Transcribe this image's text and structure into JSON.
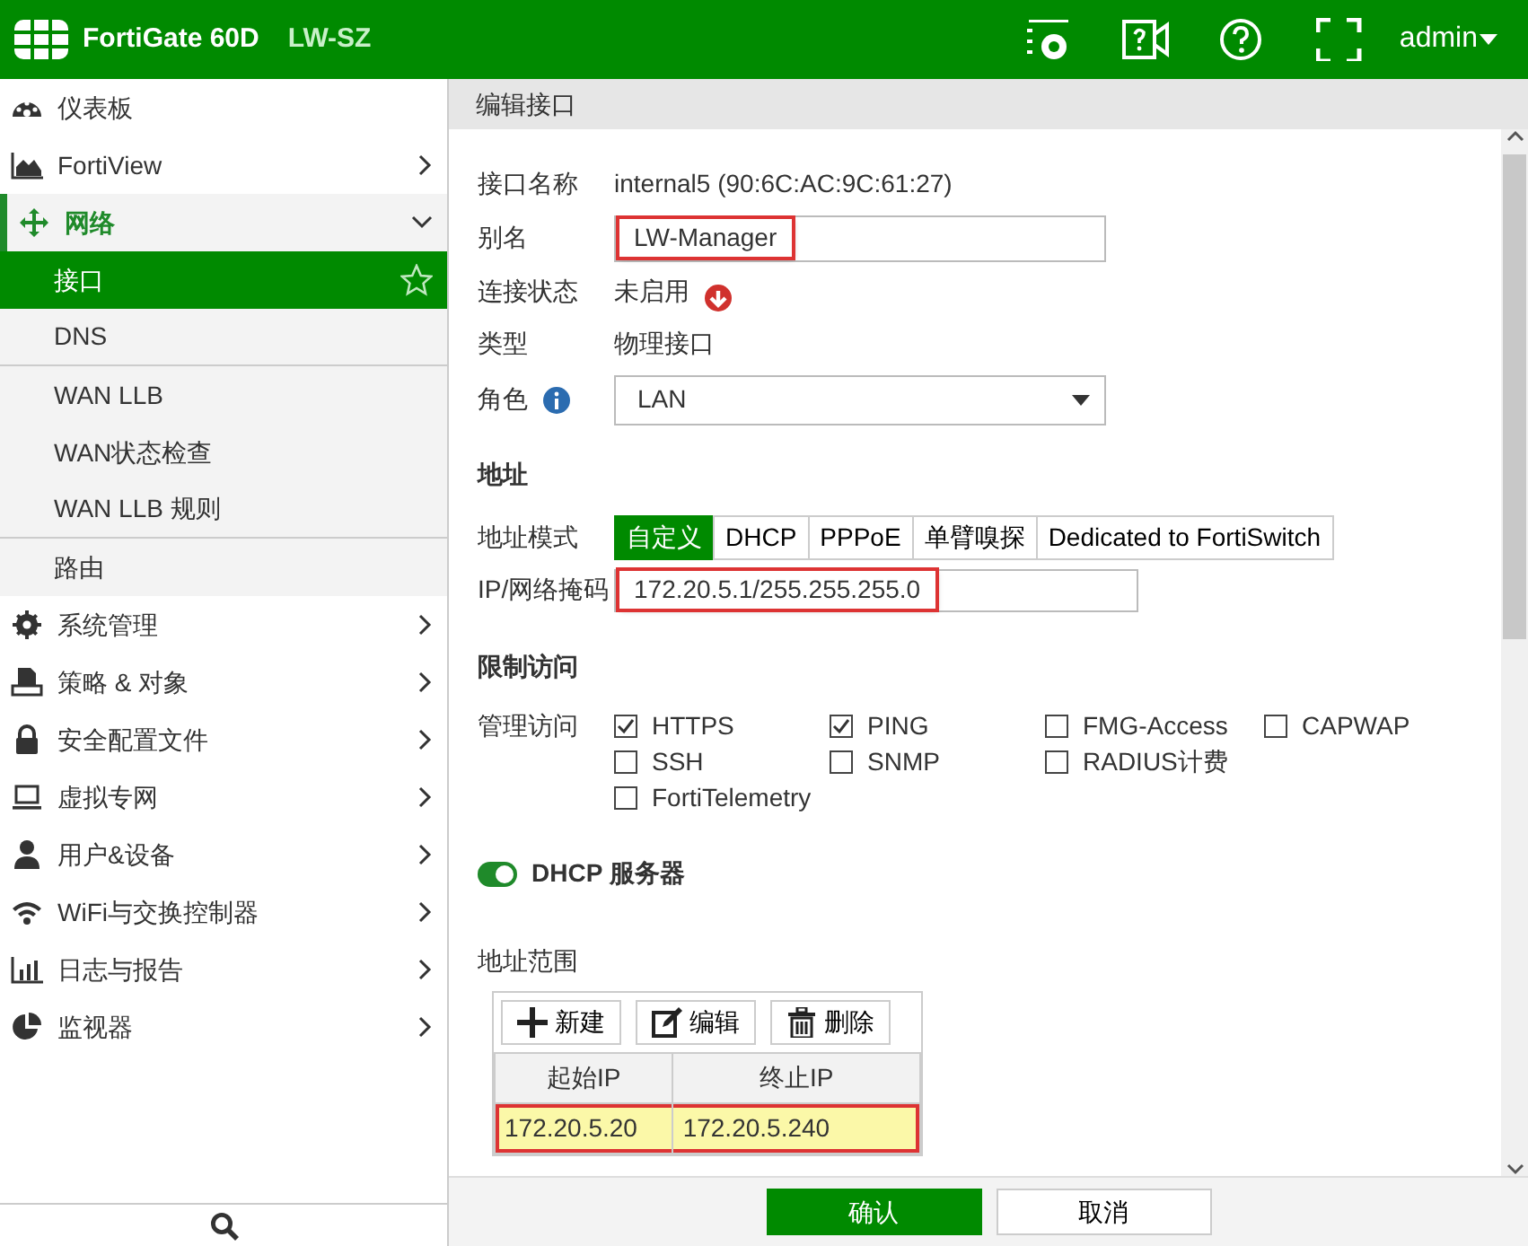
{
  "header": {
    "product": "FortiGate 60D",
    "hostname": "LW-SZ",
    "user": "admin"
  },
  "sidebar": {
    "items": [
      {
        "label": "仪表板"
      },
      {
        "label": "FortiView",
        "expanded": false
      },
      {
        "label": "网络",
        "expanded": true,
        "children": [
          {
            "label": "接口",
            "selected": true
          },
          {
            "label": "DNS",
            "selected": false
          },
          {
            "label": "WAN LLB",
            "selected": false
          },
          {
            "label": "WAN状态检查",
            "selected": false
          },
          {
            "label": "WAN LLB 规则",
            "selected": false
          },
          {
            "label": "路由",
            "selected": false
          }
        ]
      },
      {
        "label": "系统管理",
        "expanded": false
      },
      {
        "label": "策略 & 对象",
        "expanded": false
      },
      {
        "label": "安全配置文件",
        "expanded": false
      },
      {
        "label": "虚拟专网",
        "expanded": false
      },
      {
        "label": "用户&设备",
        "expanded": false
      },
      {
        "label": "WiFi与交换控制器",
        "expanded": false
      },
      {
        "label": "日志与报告",
        "expanded": false
      },
      {
        "label": "监视器",
        "expanded": false
      }
    ]
  },
  "panel": {
    "title": "编辑接口",
    "fields": [
      {
        "kind": "text",
        "label": "接口名称",
        "value": "internal5 (90:6C:AC:9C:61:27)"
      },
      {
        "kind": "input",
        "label": "别名",
        "value": "LW-Manager",
        "highlighted": true
      },
      {
        "kind": "status",
        "label": "连接状态",
        "value": "未启用",
        "up": false
      },
      {
        "kind": "text",
        "label": "类型",
        "value": "物理接口"
      },
      {
        "kind": "select",
        "label": "角色",
        "value": "LAN"
      }
    ],
    "address": {
      "title": "地址",
      "mode_label": "地址模式",
      "modes": [
        {
          "label": "自定义",
          "selected": true
        },
        {
          "label": "DHCP",
          "selected": false
        },
        {
          "label": "PPPoE",
          "selected": false
        },
        {
          "label": "单臂嗅探",
          "selected": false
        },
        {
          "label": "Dedicated to FortiSwitch",
          "selected": false
        }
      ],
      "ip_label": "IP/网络掩码",
      "ip_value": "172.20.5.1/255.255.255.0",
      "ip_highlighted": true
    },
    "access": {
      "title": "限制访问",
      "label": "管理访问",
      "rows": [
        [
          {
            "label": "HTTPS",
            "checked": true
          },
          {
            "label": "PING",
            "checked": true
          },
          {
            "label": "FMG-Access",
            "checked": false
          },
          {
            "label": "CAPWAP",
            "checked": false
          }
        ],
        [
          {
            "label": "SSH",
            "checked": false
          },
          {
            "label": "SNMP",
            "checked": false
          },
          {
            "label": "RADIUS计费",
            "checked": false
          }
        ],
        [
          {
            "label": "FortiTelemetry",
            "checked": false
          }
        ]
      ]
    },
    "dhcp": {
      "label": "DHCP 服务器",
      "on": true,
      "range_label": "地址范围",
      "toolbar": [
        "新建",
        "编辑",
        "删除"
      ],
      "columns": [
        "起始IP",
        "终止IP"
      ],
      "rows": [
        {
          "cells": [
            "172.20.5.20",
            "172.20.5.240"
          ],
          "selected": true,
          "highlighted": true
        }
      ]
    }
  },
  "footer": {
    "buttons": [
      {
        "label": "确认",
        "primary": true
      },
      {
        "label": "取消",
        "primary": false
      }
    ]
  }
}
